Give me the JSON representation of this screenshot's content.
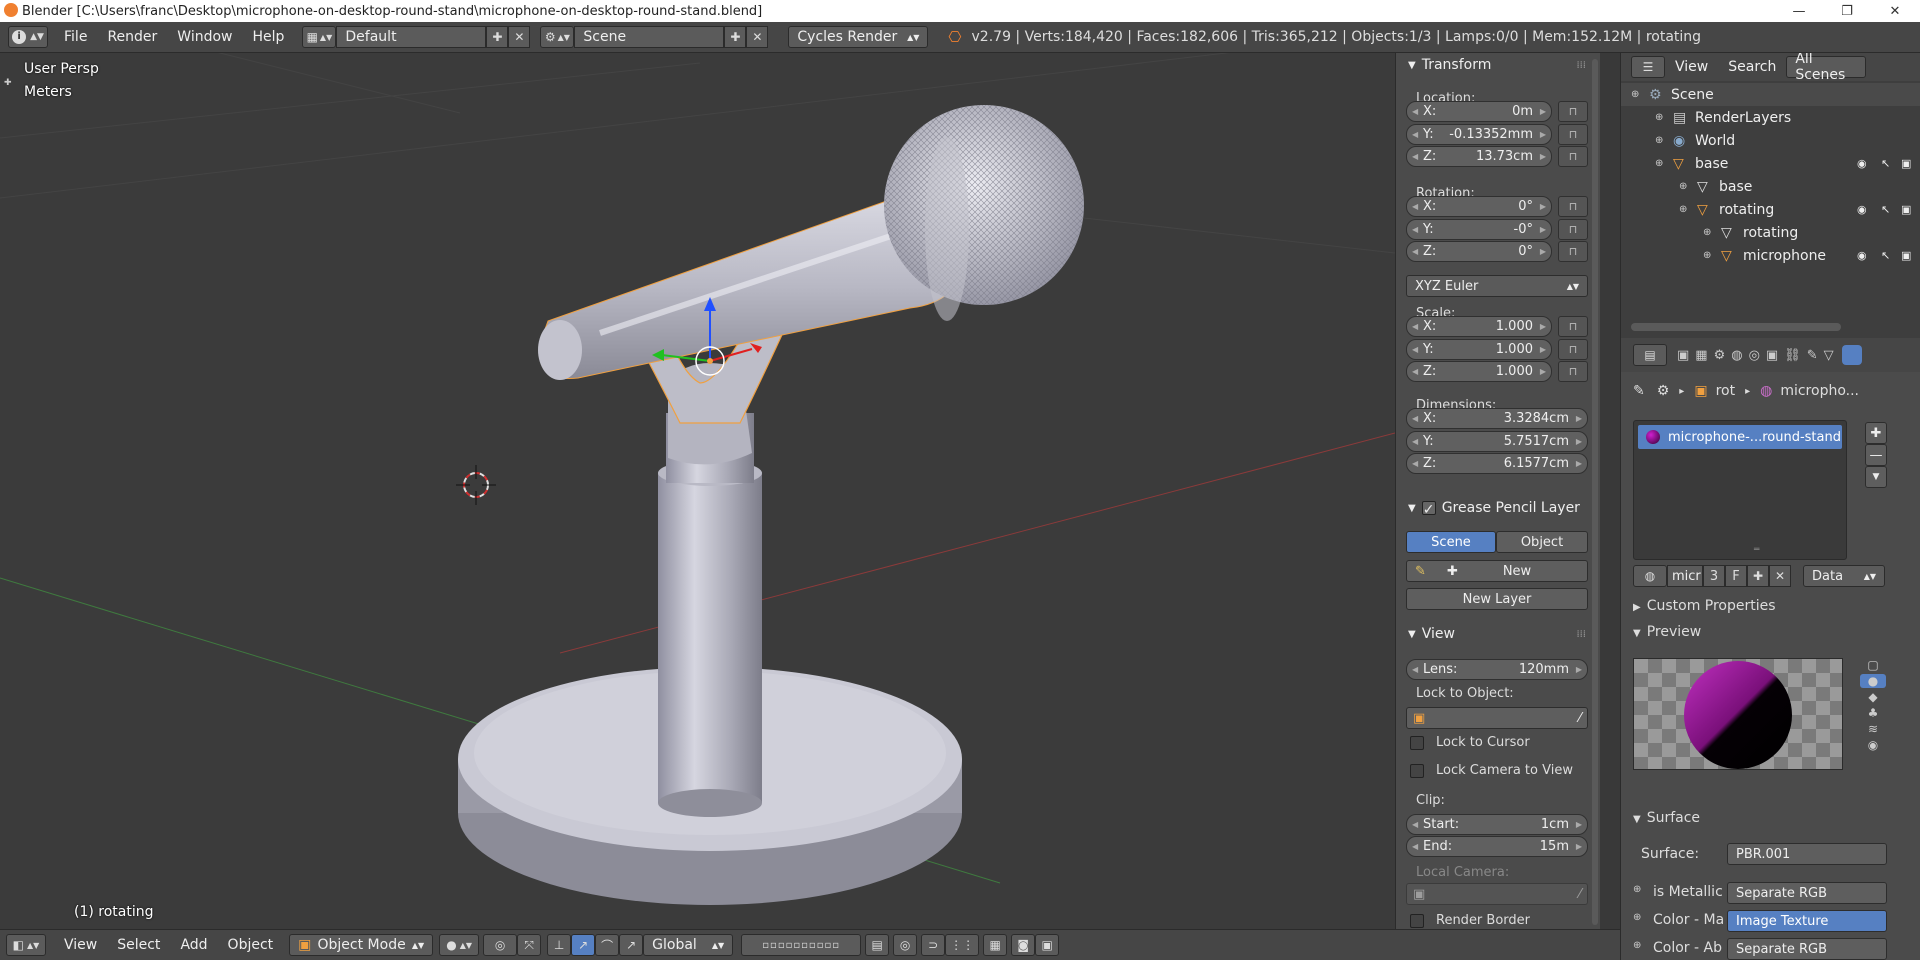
{
  "window": {
    "title": "Blender  [C:\\Users\\franc\\Desktop\\microphone-on-desktop-round-stand\\microphone-on-desktop-round-stand.blend]",
    "minimize": "—",
    "maximize": "❐",
    "close": "✕"
  },
  "header": {
    "menus": [
      "File",
      "Render",
      "Window",
      "Help"
    ],
    "layout": "Default",
    "scene": "Scene",
    "engine": "Cycles Render",
    "stats": "v2.79 | Verts:184,420 | Faces:182,606 | Tris:365,212 | Objects:1/3 | Lamps:0/0 | Mem:152.12M | rotating"
  },
  "viewport": {
    "view_name": "User Persp",
    "units": "Meters",
    "active_object": "(1) rotating"
  },
  "npanel": {
    "transform_title": "Transform",
    "location_label": "Location:",
    "location": [
      {
        "k": "X:",
        "v": "0m"
      },
      {
        "k": "Y:",
        "v": "-0.13352mm"
      },
      {
        "k": "Z:",
        "v": "13.73cm"
      }
    ],
    "rotation_label": "Rotation:",
    "rotation": [
      {
        "k": "X:",
        "v": "0°"
      },
      {
        "k": "Y:",
        "v": "-0°"
      },
      {
        "k": "Z:",
        "v": "0°"
      }
    ],
    "rotation_mode": "XYZ Euler",
    "scale_label": "Scale:",
    "scale": [
      {
        "k": "X:",
        "v": "1.000"
      },
      {
        "k": "Y:",
        "v": "1.000"
      },
      {
        "k": "Z:",
        "v": "1.000"
      }
    ],
    "dimensions_label": "Dimensions:",
    "dimensions": [
      {
        "k": "X:",
        "v": "3.3284cm"
      },
      {
        "k": "Y:",
        "v": "5.7517cm"
      },
      {
        "k": "Z:",
        "v": "6.1577cm"
      }
    ],
    "grease_title": "Grease Pencil Layer",
    "gp_scene": "Scene",
    "gp_object": "Object",
    "gp_new": "New",
    "gp_new_layer": "New Layer",
    "view_title": "View",
    "lens_label": "Lens:",
    "lens_value": "120mm",
    "lock_object_label": "Lock to Object:",
    "lock_cursor": "Lock to Cursor",
    "lock_camera": "Lock Camera to View",
    "clip_label": "Clip:",
    "clip_start_k": "Start:",
    "clip_start_v": "1cm",
    "clip_end_k": "End:",
    "clip_end_v": "15m",
    "local_camera": "Local Camera:",
    "render_border": "Render Border"
  },
  "outliner": {
    "view": "View",
    "search": "Search",
    "filter": "All Scenes",
    "rows": [
      {
        "label": "Scene",
        "indent": 0
      },
      {
        "label": "RenderLayers",
        "indent": 1
      },
      {
        "label": "World",
        "indent": 1
      },
      {
        "label": "base",
        "indent": 1
      },
      {
        "label": "base",
        "indent": 2
      },
      {
        "label": "rotating",
        "indent": 2
      },
      {
        "label": "rotating",
        "indent": 3
      },
      {
        "label": "microphone",
        "indent": 3
      }
    ]
  },
  "properties": {
    "breadcrumb_obj": "rot",
    "breadcrumb_mat": "micropho...",
    "material_slot": "microphone-...round-stand",
    "mat_short": "micr",
    "mat_users": "3",
    "mat_fake": "F",
    "link": "Data",
    "custom_props": "Custom Properties",
    "preview": "Preview",
    "surface_title": "Surface",
    "surface_label": "Surface:",
    "surface_value": "PBR.001",
    "inputs": [
      {
        "k": "is Metallic",
        "v": "Separate RGB"
      },
      {
        "k": "Color - Ma",
        "v": "Image Texture"
      },
      {
        "k": "Color - Ab",
        "v": "Separate RGB"
      }
    ]
  },
  "bottombar": {
    "view": "View",
    "select": "Select",
    "add": "Add",
    "object": "Object",
    "mode": "Object Mode",
    "orientation": "Global"
  },
  "colors": {
    "accent": "#5680c2",
    "selected_outline": "#f0a040",
    "header": "#464646",
    "viewport": "#3b3b3b"
  }
}
